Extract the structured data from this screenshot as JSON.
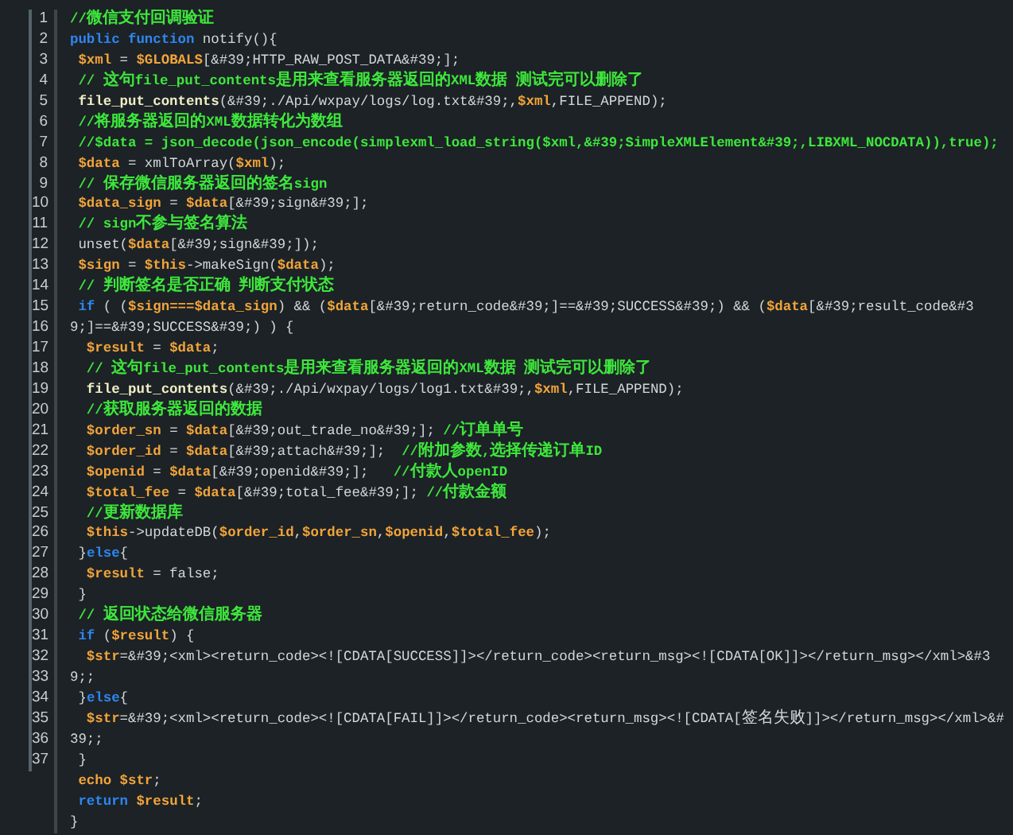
{
  "editor": {
    "lines": [
      {
        "number": "1",
        "tokens": [
          {
            "kind": "comment",
            "text": "//微信支付回调验证"
          }
        ]
      },
      {
        "number": "2",
        "tokens": [
          {
            "kind": "keyword",
            "text": "public function"
          },
          {
            "kind": "plain",
            "text": " notify(){"
          }
        ]
      },
      {
        "number": "3",
        "tokens": [
          {
            "kind": "variable",
            "text": " $xml"
          },
          {
            "kind": "plain",
            "text": " = "
          },
          {
            "kind": "variable",
            "text": "$GLOBALS"
          },
          {
            "kind": "plain",
            "text": "[&#39;HTTP_RAW_POST_DATA&#39;];"
          }
        ]
      },
      {
        "number": "4",
        "tokens": [
          {
            "kind": "comment",
            "text": " // 这句file_put_contents是用来查看服务器返回的XML数据 测试完可以删除了"
          }
        ]
      },
      {
        "number": "5",
        "tokens": [
          {
            "kind": "function",
            "text": " file_put_contents"
          },
          {
            "kind": "plain",
            "text": "(&#39;./Api/wxpay/logs/log.txt&#39;,"
          },
          {
            "kind": "variable",
            "text": "$xml"
          },
          {
            "kind": "plain",
            "text": ",FILE_APPEND);"
          }
        ]
      },
      {
        "number": "6",
        "tokens": [
          {
            "kind": "comment",
            "text": " //将服务器返回的XML数据转化为数组"
          }
        ]
      },
      {
        "number": "7",
        "tokens": [
          {
            "kind": "comment",
            "text": " //$data = json_decode(json_encode(simplexml_load_string($xml,&#39;SimpleXMLElement&#39;,LIBXML_NOCDATA)),true);"
          }
        ]
      },
      {
        "number": "8",
        "tokens": [
          {
            "kind": "variable",
            "text": " $data"
          },
          {
            "kind": "plain",
            "text": " = xmlToArray("
          },
          {
            "kind": "variable",
            "text": "$xml"
          },
          {
            "kind": "plain",
            "text": ");"
          }
        ]
      },
      {
        "number": "9",
        "tokens": [
          {
            "kind": "comment",
            "text": " // 保存微信服务器返回的签名sign"
          }
        ]
      },
      {
        "number": "10",
        "tokens": [
          {
            "kind": "variable",
            "text": " $data_sign"
          },
          {
            "kind": "plain",
            "text": " = "
          },
          {
            "kind": "variable",
            "text": "$data"
          },
          {
            "kind": "plain",
            "text": "[&#39;sign&#39;];"
          }
        ]
      },
      {
        "number": "11",
        "tokens": [
          {
            "kind": "comment",
            "text": " // sign不参与签名算法"
          }
        ]
      },
      {
        "number": "12",
        "tokens": [
          {
            "kind": "plain",
            "text": " unset("
          },
          {
            "kind": "variable",
            "text": "$data"
          },
          {
            "kind": "plain",
            "text": "[&#39;sign&#39;]);"
          }
        ]
      },
      {
        "number": "13",
        "tokens": [
          {
            "kind": "variable",
            "text": " $sign"
          },
          {
            "kind": "plain",
            "text": " = "
          },
          {
            "kind": "variable",
            "text": "$this"
          },
          {
            "kind": "plain",
            "text": "->makeSign("
          },
          {
            "kind": "variable",
            "text": "$data"
          },
          {
            "kind": "plain",
            "text": ");"
          }
        ]
      },
      {
        "number": "14",
        "tokens": [
          {
            "kind": "comment",
            "text": " // 判断签名是否正确 判断支付状态"
          }
        ]
      },
      {
        "number": "15",
        "tokens": [
          {
            "kind": "keyword",
            "text": " if"
          },
          {
            "kind": "plain",
            "text": " ( ("
          },
          {
            "kind": "variable",
            "text": "$sign===$data_sign"
          },
          {
            "kind": "plain",
            "text": ") && ("
          },
          {
            "kind": "variable",
            "text": "$data"
          },
          {
            "kind": "plain",
            "text": "[&#39;return_code&#39;]==&#39;SUCCESS&#39;) && ("
          },
          {
            "kind": "variable",
            "text": "$data"
          },
          {
            "kind": "plain",
            "text": "[&#39;result_code&#3"
          }
        ]
      },
      {
        "number": "16",
        "tokens": [
          {
            "kind": "plain",
            "text": "9;]==&#39;SUCCESS&#39;) ) {"
          }
        ]
      },
      {
        "number": "17",
        "tokens": [
          {
            "kind": "variable",
            "text": "  $result"
          },
          {
            "kind": "plain",
            "text": " = "
          },
          {
            "kind": "variable",
            "text": "$data"
          },
          {
            "kind": "plain",
            "text": ";"
          }
        ]
      },
      {
        "number": "18",
        "tokens": [
          {
            "kind": "comment",
            "text": "  // 这句file_put_contents是用来查看服务器返回的XML数据 测试完可以删除了"
          }
        ]
      },
      {
        "number": "19",
        "tokens": [
          {
            "kind": "function",
            "text": "  file_put_contents"
          },
          {
            "kind": "plain",
            "text": "(&#39;./Api/wxpay/logs/log1.txt&#39;,"
          },
          {
            "kind": "variable",
            "text": "$xml"
          },
          {
            "kind": "plain",
            "text": ",FILE_APPEND);"
          }
        ]
      },
      {
        "number": "20",
        "tokens": [
          {
            "kind": "comment",
            "text": "  //获取服务器返回的数据"
          }
        ]
      },
      {
        "number": "21",
        "tokens": [
          {
            "kind": "variable",
            "text": "  $order_sn"
          },
          {
            "kind": "plain",
            "text": " = "
          },
          {
            "kind": "variable",
            "text": "$data"
          },
          {
            "kind": "plain",
            "text": "[&#39;out_trade_no&#39;]; "
          },
          {
            "kind": "comment",
            "text": "//订单单号"
          }
        ]
      },
      {
        "number": "22",
        "tokens": [
          {
            "kind": "variable",
            "text": "  $order_id"
          },
          {
            "kind": "plain",
            "text": " = "
          },
          {
            "kind": "variable",
            "text": "$data"
          },
          {
            "kind": "plain",
            "text": "[&#39;attach&#39;];  "
          },
          {
            "kind": "comment",
            "text": "//附加参数,选择传递订单ID"
          }
        ]
      },
      {
        "number": "23",
        "tokens": [
          {
            "kind": "variable",
            "text": "  $openid"
          },
          {
            "kind": "plain",
            "text": " = "
          },
          {
            "kind": "variable",
            "text": "$data"
          },
          {
            "kind": "plain",
            "text": "[&#39;openid&#39;];   "
          },
          {
            "kind": "comment",
            "text": "//付款人openID"
          }
        ]
      },
      {
        "number": "24",
        "tokens": [
          {
            "kind": "variable",
            "text": "  $total_fee"
          },
          {
            "kind": "plain",
            "text": " = "
          },
          {
            "kind": "variable",
            "text": "$data"
          },
          {
            "kind": "plain",
            "text": "[&#39;total_fee&#39;]; "
          },
          {
            "kind": "comment",
            "text": "//付款金额"
          }
        ]
      },
      {
        "number": "25",
        "tokens": [
          {
            "kind": "comment",
            "text": "  //更新数据库"
          }
        ]
      },
      {
        "number": "26",
        "tokens": [
          {
            "kind": "variable",
            "text": "  $this"
          },
          {
            "kind": "plain",
            "text": "->updateDB("
          },
          {
            "kind": "variable",
            "text": "$order_id"
          },
          {
            "kind": "plain",
            "text": ","
          },
          {
            "kind": "variable",
            "text": "$order_sn"
          },
          {
            "kind": "plain",
            "text": ","
          },
          {
            "kind": "variable",
            "text": "$openid"
          },
          {
            "kind": "plain",
            "text": ","
          },
          {
            "kind": "variable",
            "text": "$total_fee"
          },
          {
            "kind": "plain",
            "text": ");"
          }
        ]
      },
      {
        "number": "27",
        "tokens": [
          {
            "kind": "plain",
            "text": " }"
          },
          {
            "kind": "keyword",
            "text": "else"
          },
          {
            "kind": "plain",
            "text": "{"
          }
        ]
      },
      {
        "number": "28",
        "tokens": [
          {
            "kind": "variable",
            "text": "  $result"
          },
          {
            "kind": "plain",
            "text": " = false;"
          }
        ]
      },
      {
        "number": "29",
        "tokens": [
          {
            "kind": "plain",
            "text": " }"
          }
        ]
      },
      {
        "number": "30",
        "tokens": [
          {
            "kind": "comment",
            "text": " // 返回状态给微信服务器"
          }
        ]
      },
      {
        "number": "31",
        "tokens": [
          {
            "kind": "keyword",
            "text": " if"
          },
          {
            "kind": "plain",
            "text": " ("
          },
          {
            "kind": "variable",
            "text": "$result"
          },
          {
            "kind": "plain",
            "text": ") {"
          }
        ]
      },
      {
        "number": "32",
        "tokens": [
          {
            "kind": "variable",
            "text": "  $str"
          },
          {
            "kind": "plain",
            "text": "=&#39;<xml><return_code><![CDATA[SUCCESS]]></return_code><return_msg><![CDATA[OK]]></return_msg></xml>&#3"
          }
        ]
      },
      {
        "number": "33",
        "tokens": [
          {
            "kind": "plain",
            "text": "9;;"
          }
        ]
      },
      {
        "number": "34",
        "tokens": [
          {
            "kind": "plain",
            "text": " }"
          },
          {
            "kind": "keyword",
            "text": "else"
          },
          {
            "kind": "plain",
            "text": "{"
          }
        ]
      },
      {
        "number": "35",
        "tokens": [
          {
            "kind": "variable",
            "text": "  $str"
          },
          {
            "kind": "plain",
            "text": "=&#39;<xml><return_code><![CDATA[FAIL]]></return_code><return_msg><![CDATA[签名失败]]></return_msg></xml>&#"
          }
        ]
      },
      {
        "number": "36",
        "tokens": [
          {
            "kind": "plain",
            "text": "39;;"
          }
        ]
      },
      {
        "number": "37",
        "tokens": [
          {
            "kind": "plain",
            "text": " }"
          }
        ]
      },
      {
        "tokens": [
          {
            "kind": "builtin",
            "text": " echo"
          },
          {
            "kind": "variable",
            "text": " $str"
          },
          {
            "kind": "plain",
            "text": ";"
          }
        ]
      },
      {
        "tokens": [
          {
            "kind": "keyword",
            "text": " return"
          },
          {
            "kind": "variable",
            "text": " $result"
          },
          {
            "kind": "plain",
            "text": ";"
          }
        ]
      },
      {
        "tokens": [
          {
            "kind": "plain",
            "text": "}"
          }
        ]
      }
    ]
  }
}
